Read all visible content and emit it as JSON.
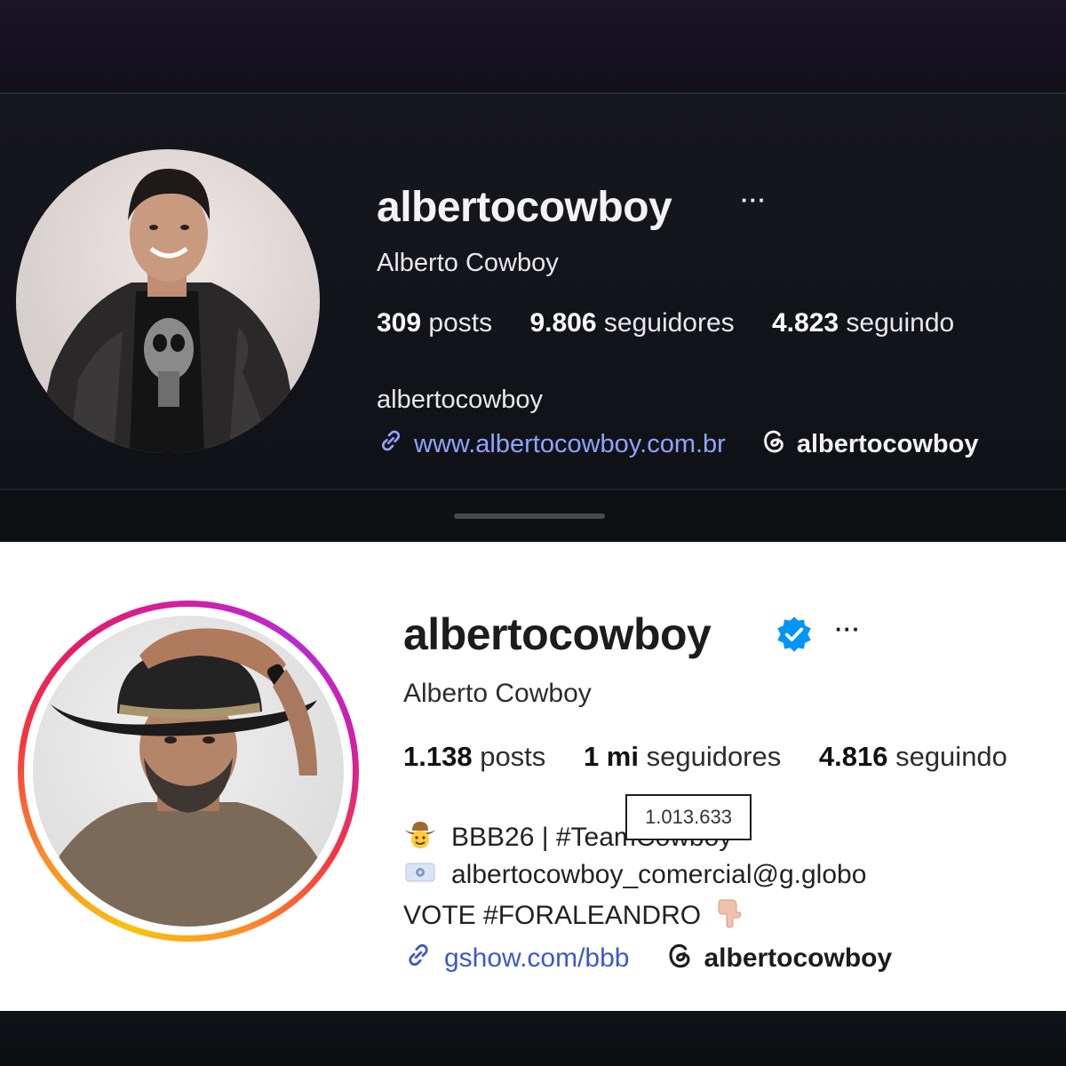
{
  "old_profile": {
    "username": "albertocowboy",
    "more": "···",
    "full_name": "Alberto Cowboy",
    "stats": {
      "posts_count": "309",
      "posts_label": "posts",
      "followers_count": "9.806",
      "followers_label": "seguidores",
      "following_count": "4.823",
      "following_label": "seguindo"
    },
    "bio": "albertocowboy",
    "link_url": "www.albertocowboy.com.br",
    "threads_handle": "albertocowboy"
  },
  "new_profile": {
    "username": "albertocowboy",
    "more": "···",
    "full_name": "Alberto Cowboy",
    "stats": {
      "posts_count": "1.138",
      "posts_label": "posts",
      "followers_count": "1 mi",
      "followers_label": "seguidores",
      "following_count": "4.816",
      "following_label": "seguindo"
    },
    "followers_tooltip": "1.013.633",
    "bio_lines": [
      "BBB26 | #TeamCowboy",
      "albertocowboy_comercial@g.globo",
      "VOTE #FORALEANDRO"
    ],
    "link_url": "gshow.com/bbb",
    "threads_handle": "albertocowboy"
  },
  "icons": [
    "link-icon",
    "threads-icon",
    "verified-badge-icon",
    "cowboy-emoji-icon",
    "email-card-icon",
    "pointing-down-emoji-icon"
  ],
  "colors": {
    "dark_link": "#8ea4ff",
    "light_link": "#3d58c9",
    "verified": "#0095f6",
    "story_ring_start": "#f9c20c",
    "story_ring_end": "#d01fa8"
  }
}
